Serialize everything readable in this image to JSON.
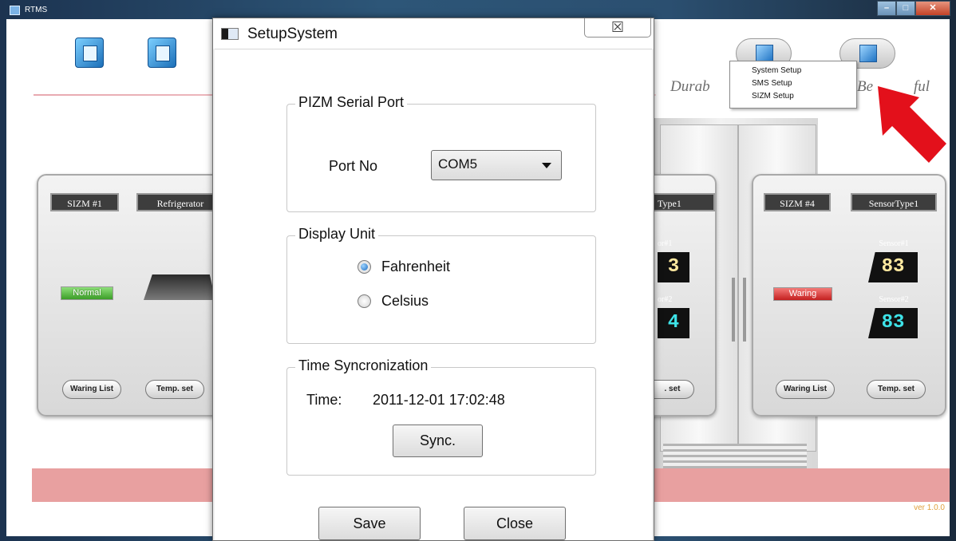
{
  "window": {
    "title": "RTMS"
  },
  "slogan": {
    "left": "Durab",
    "right": "Be",
    "right_tail": "ful"
  },
  "context_menu": {
    "items": [
      "System Setup",
      "SMS Setup",
      "SIZM Setup"
    ]
  },
  "cards": {
    "c1": {
      "id": "SIZM #1",
      "type": "Refrigerator",
      "status": "Normal",
      "btn_list": "Waring List",
      "btn_temp": "Temp. set"
    },
    "c3": {
      "type_partial": "Type1",
      "s1": "or#1",
      "s1_val": "3",
      "s2": "or#2",
      "s2_val": "4",
      "btn_temp": ". set"
    },
    "c4": {
      "id": "SIZM #4",
      "type": "SensorType1",
      "status": "Waring",
      "sensor1_label": "Sensor#1",
      "sensor1_value": "83",
      "sensor2_label": "Sensor#2",
      "sensor2_value": "83",
      "btn_list": "Waring List",
      "btn_temp": "Temp. set"
    }
  },
  "version": "ver 1.0.0",
  "dialog": {
    "title": "SetupSystem",
    "close_glyph": "☒",
    "serial": {
      "title": "PIZM Serial Port",
      "port_label": "Port No",
      "port_value": "COM5"
    },
    "unit": {
      "title": "Display Unit",
      "options": [
        "Fahrenheit",
        "Celsius"
      ],
      "selected": "Fahrenheit"
    },
    "sync": {
      "title": "Time Syncronization",
      "time_label": "Time:",
      "time_value": "2011-12-01 17:02:48",
      "button": "Sync."
    },
    "save": "Save",
    "close": "Close"
  },
  "colors": {
    "accent_red": "#e3101b",
    "title_blue": "#2d5678",
    "badge_ok": "#4cae36",
    "badge_warn": "#d42a2a"
  }
}
